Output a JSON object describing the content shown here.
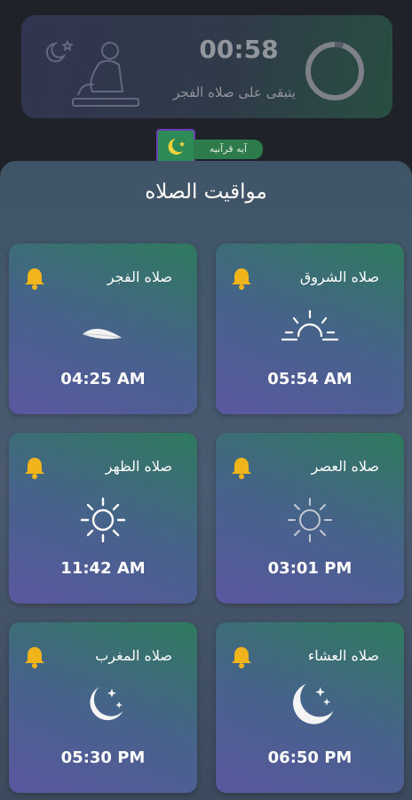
{
  "countdown": {
    "time": "00:58",
    "remaining_label": "يتبقى على صلاه الفجر",
    "progress": 0.05
  },
  "verse_button": {
    "label": "آيه قرآنيه"
  },
  "prayer_times": {
    "title": "مواقيت الصلاه",
    "cards": [
      {
        "name": "صلاه الشروق",
        "time": "05:54 AM",
        "icon": "sunrise-icon"
      },
      {
        "name": "صلاه الفجر",
        "time": "04:25 AM",
        "icon": "feather-icon"
      },
      {
        "name": "صلاه العصر",
        "time": "03:01 PM",
        "icon": "sun-icon"
      },
      {
        "name": "صلاه الظهر",
        "time": "11:42 AM",
        "icon": "sun-icon"
      },
      {
        "name": "صلاه العشاء",
        "time": "06:50 PM",
        "icon": "moon-stars-icon"
      },
      {
        "name": "صلاه المغرب",
        "time": "05:30 PM",
        "icon": "moon-stars-icon"
      }
    ]
  },
  "colors": {
    "background": "#1f2228",
    "bell": "#f2b41b",
    "accent_green": "#2f7a5e",
    "accent_purple": "#5a57a0"
  }
}
